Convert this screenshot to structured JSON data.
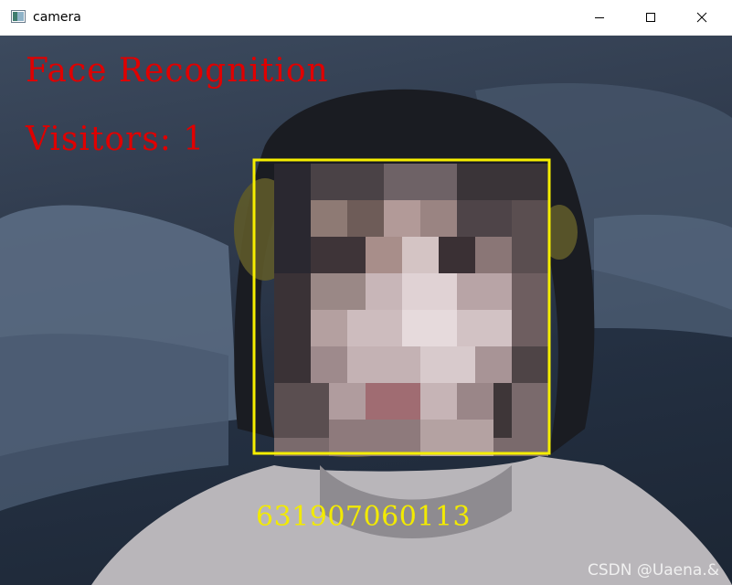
{
  "window": {
    "title": "camera",
    "app_icon": "window-app-icon",
    "controls": [
      "minimize-icon",
      "maximize-icon",
      "close-icon"
    ]
  },
  "overlay": {
    "heading": "Face Recognition",
    "visitors": "Visitors: 1",
    "face_id": "631907060113",
    "text_color_heading": "#e00000",
    "text_color_id": "#f2ea00",
    "box_color": "#f5ee00"
  },
  "watermark": "CSDN @Uaena.&"
}
